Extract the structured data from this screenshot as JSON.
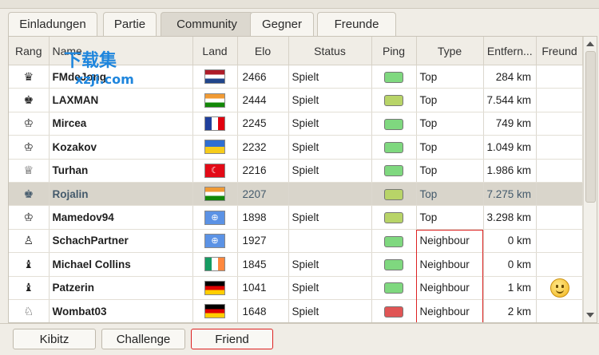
{
  "tabs": [
    {
      "label": "Einladungen",
      "active": false
    },
    {
      "label": "Partie",
      "active": false
    },
    {
      "label": "Community",
      "active": true
    },
    {
      "label": "Gegner",
      "active": false
    },
    {
      "label": "Freunde",
      "active": false
    }
  ],
  "columns": {
    "rank": "Rang",
    "name": "Name",
    "land": "Land",
    "elo": "Elo",
    "status": "Status",
    "ping": "Ping",
    "type": "Type",
    "distance": "Entfern...",
    "friend": "Freund"
  },
  "rows": [
    {
      "rank_icon": "queen-icon",
      "rank_glyph": "♛",
      "name": "FMdeJong",
      "flag": "nl",
      "elo": "2466",
      "status": "Spielt",
      "ping": "#7fd87f",
      "type": "Top",
      "distance": "284 km",
      "friend": ""
    },
    {
      "rank_icon": "king-dark-icon",
      "rank_glyph": "♚",
      "name": "LAXMAN",
      "flag": "in",
      "elo": "2444",
      "status": "Spielt",
      "ping": "#b8d468",
      "type": "Top",
      "distance": "7.544 km",
      "friend": ""
    },
    {
      "rank_icon": "king-icon",
      "rank_glyph": "♔",
      "name": "Mircea",
      "flag": "fr",
      "elo": "2245",
      "status": "Spielt",
      "ping": "#7fd87f",
      "type": "Top",
      "distance": "749 km",
      "friend": ""
    },
    {
      "rank_icon": "king-icon",
      "rank_glyph": "♔",
      "name": "Kozakov",
      "flag": "ua",
      "elo": "2232",
      "status": "Spielt",
      "ping": "#7fd87f",
      "type": "Top",
      "distance": "1.049 km",
      "friend": ""
    },
    {
      "rank_icon": "queen-icon",
      "rank_glyph": "♕",
      "name": "Turhan",
      "flag": "tr",
      "elo": "2216",
      "status": "Spielt",
      "ping": "#7fd87f",
      "type": "Top",
      "distance": "1.986 km",
      "friend": ""
    },
    {
      "rank_icon": "king-dark-icon",
      "rank_glyph": "♚",
      "name": "Rojalin",
      "flag": "in",
      "elo": "2207",
      "status": "",
      "ping": "#b8d468",
      "type": "Top",
      "distance": "7.275 km",
      "friend": "",
      "selected": true
    },
    {
      "rank_icon": "king-icon",
      "rank_glyph": "♔",
      "name": "Mamedov94",
      "flag": "un",
      "elo": "1898",
      "status": "Spielt",
      "ping": "#b8d468",
      "type": "Top",
      "distance": "3.298 km",
      "friend": ""
    },
    {
      "rank_icon": "pawn-icon",
      "rank_glyph": "♙",
      "name": "SchachPartner",
      "flag": "un",
      "elo": "1927",
      "status": "",
      "ping": "#7fd87f",
      "type": "Neighbour",
      "distance": "0 km",
      "friend": ""
    },
    {
      "rank_icon": "bishop-icon",
      "rank_glyph": "♝",
      "name": "Michael Collins",
      "flag": "ie",
      "elo": "1845",
      "status": "Spielt",
      "ping": "#7fd87f",
      "type": "Neighbour",
      "distance": "0 km",
      "friend": ""
    },
    {
      "rank_icon": "bishop-icon",
      "rank_glyph": "♝",
      "name": "Patzerin",
      "flag": "de",
      "elo": "1041",
      "status": "Spielt",
      "ping": "#7fd87f",
      "type": "Neighbour",
      "distance": "1 km",
      "friend": "smiley"
    },
    {
      "rank_icon": "knight-icon",
      "rank_glyph": "♘",
      "name": "Wombat03",
      "flag": "de",
      "elo": "1648",
      "status": "Spielt",
      "ping": "#e05555",
      "type": "Neighbour",
      "distance": "2 km",
      "friend": ""
    }
  ],
  "buttons": {
    "kibitz": "Kibitz",
    "challenge": "Challenge",
    "friend": "Friend"
  },
  "watermark": {
    "big": "下载集",
    "small": "xzji.com"
  }
}
